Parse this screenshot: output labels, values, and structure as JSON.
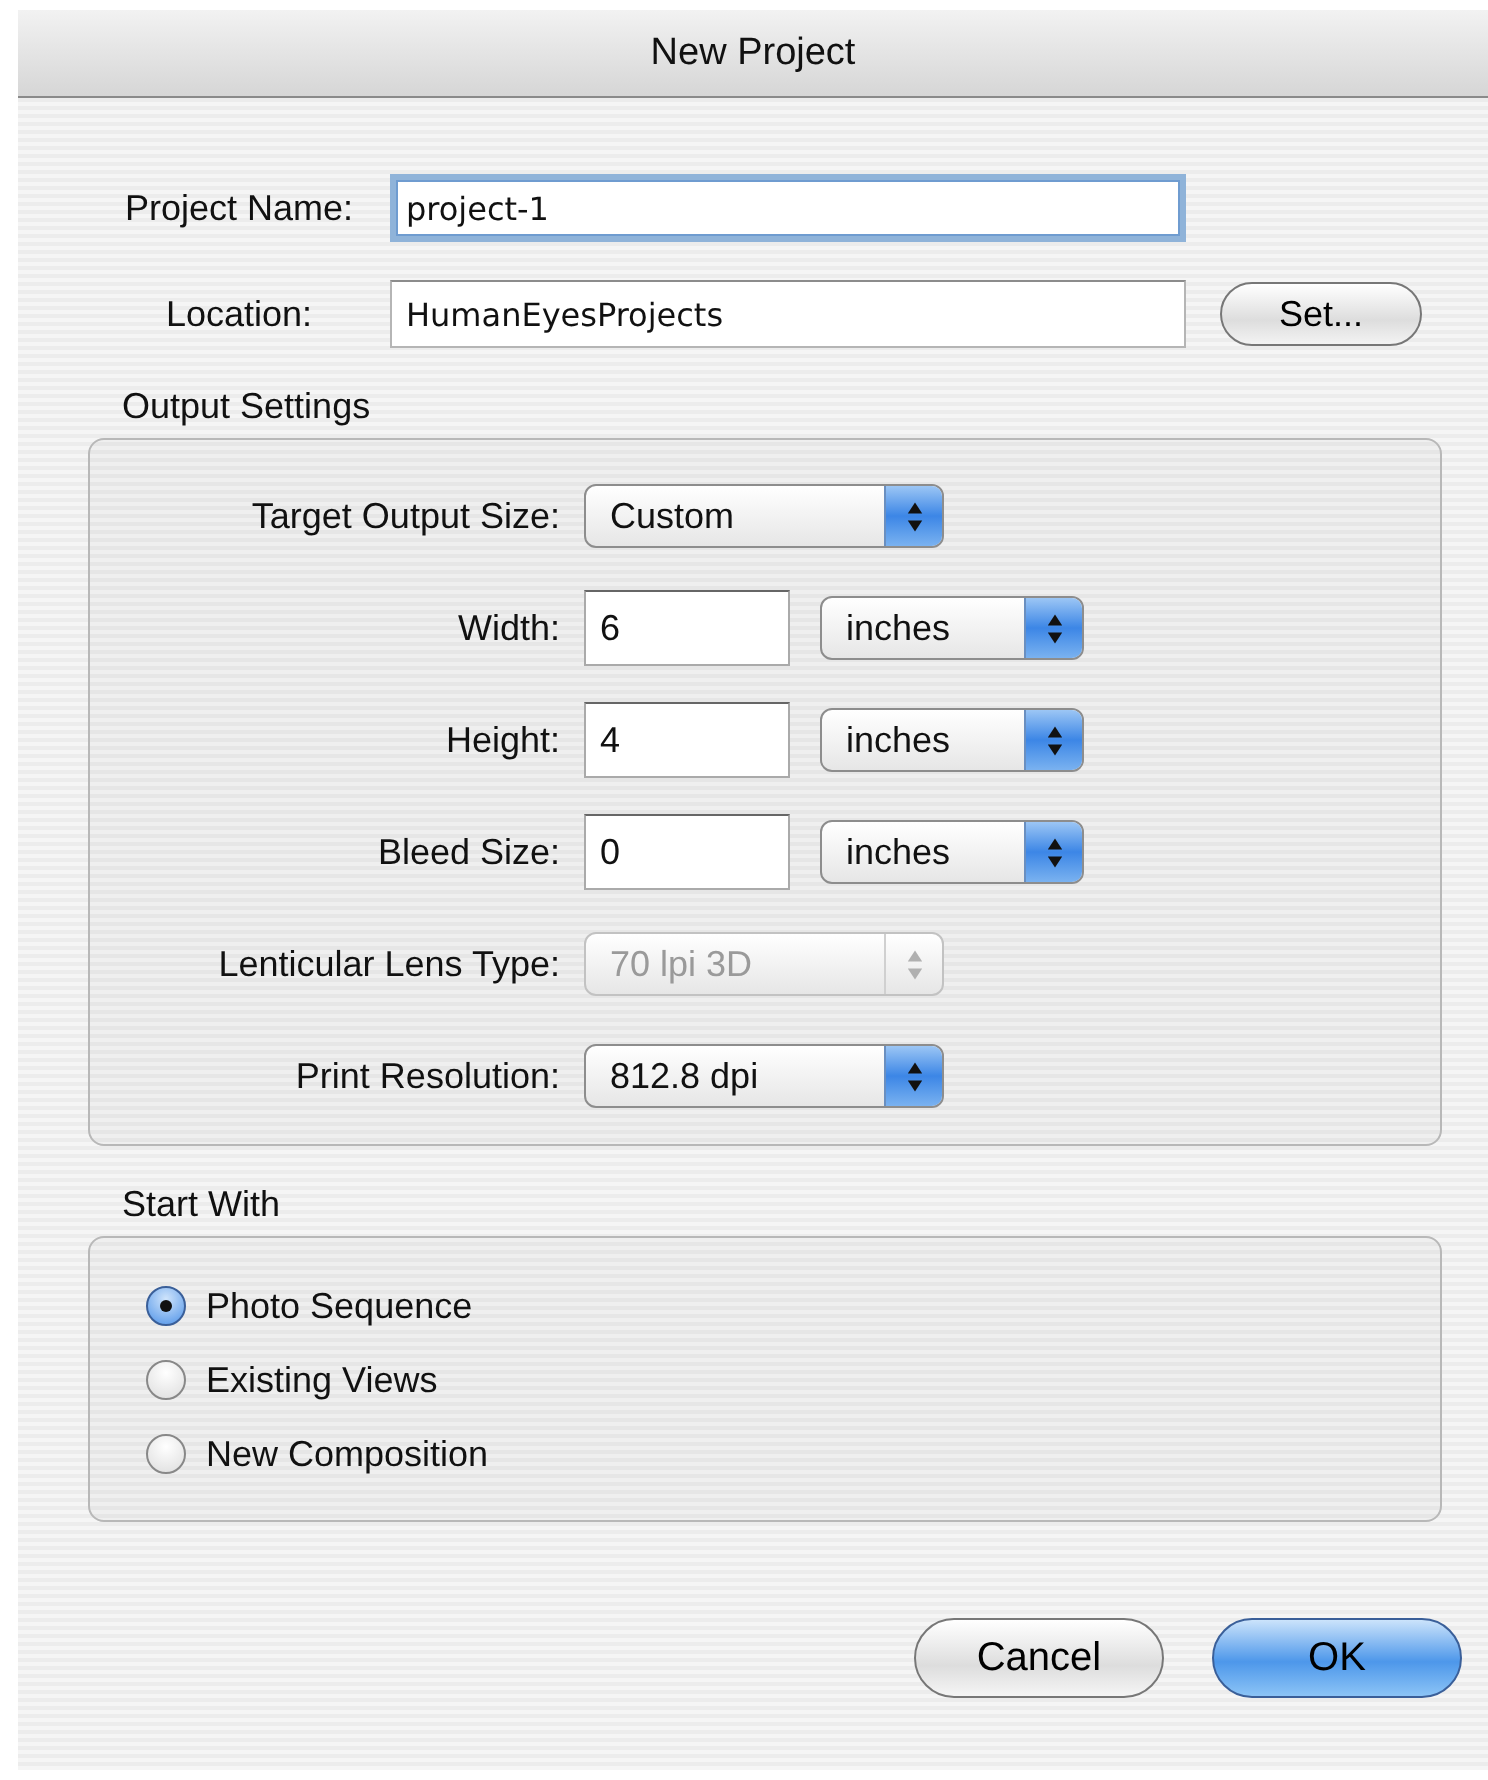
{
  "window": {
    "title": "New Project"
  },
  "fields": [
    {
      "label": "Project Name:",
      "value": "project-1",
      "focused": true
    },
    {
      "label": "Location:",
      "value": "HumanEyesProjects",
      "focused": false
    }
  ],
  "set_button": "Set...",
  "output_settings": {
    "title": "Output Settings",
    "rows": [
      {
        "kind": "popup",
        "label": "Target Output Size:",
        "value": "Custom",
        "disabled": false
      },
      {
        "kind": "number",
        "label": "Width:",
        "value": "6",
        "unit": "inches"
      },
      {
        "kind": "number",
        "label": "Height:",
        "value": "4",
        "unit": "inches"
      },
      {
        "kind": "number",
        "label": "Bleed Size:",
        "value": "0",
        "unit": "inches"
      },
      {
        "kind": "popup",
        "label": "Lenticular Lens Type:",
        "value": "70 lpi 3D",
        "disabled": true
      },
      {
        "kind": "popup",
        "label": "Print Resolution:",
        "value": "812.8 dpi",
        "disabled": false
      }
    ]
  },
  "start_with": {
    "title": "Start With",
    "options": [
      {
        "label": "Photo Sequence",
        "selected": true
      },
      {
        "label": "Existing Views",
        "selected": false
      },
      {
        "label": "New Composition",
        "selected": false
      }
    ]
  },
  "buttons": [
    {
      "label": "Cancel",
      "default": false
    },
    {
      "label": "OK",
      "default": true
    }
  ]
}
